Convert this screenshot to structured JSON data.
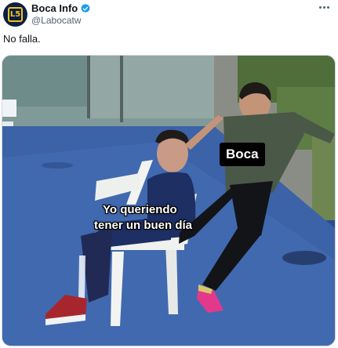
{
  "author": {
    "display_name": "Boca Info",
    "handle": "@Labocatw",
    "avatar_icon": "boca-info-logo-icon",
    "verified_icon": "verified-badge-icon",
    "verified_color": "#1d9bf0"
  },
  "more_icon": "more-options-icon",
  "tweet": {
    "text": "No falla."
  },
  "media": {
    "label_kicker": "Boca",
    "label_sitter_line1": "Yo queriendo",
    "label_sitter_line2": "tener un buen día"
  },
  "colors": {
    "text_primary": "#0f1419",
    "text_secondary": "#536471",
    "avatar_bg": "#0c1f44",
    "avatar_accent": "#f2c318"
  }
}
